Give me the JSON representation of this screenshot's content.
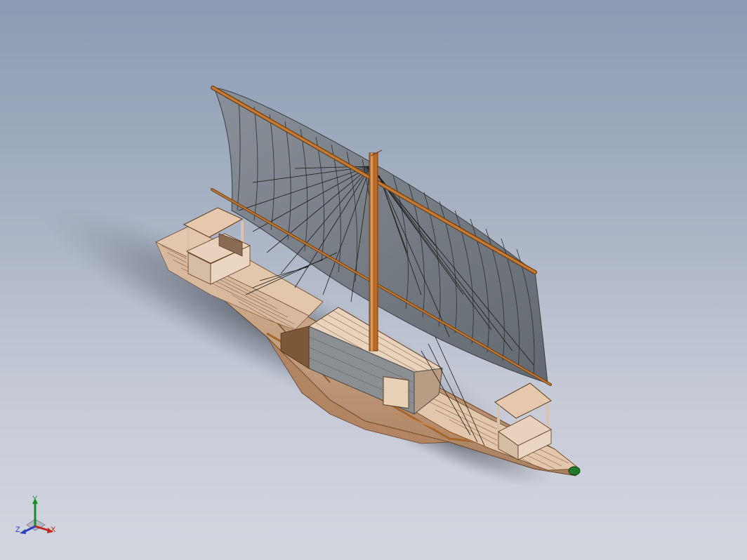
{
  "viewport": {
    "background_top": "#8a9bb3",
    "background_bottom": "#d3d6df",
    "model": "sailing-boat-3d-model"
  },
  "triad": {
    "x_label": "X",
    "y_label": "Y",
    "z_label": "Z",
    "x_color": "#c2281f",
    "y_color": "#1d8a2a",
    "z_color": "#2a3fc4"
  },
  "colors": {
    "wood_light": "#e8cdb4",
    "wood_mid": "#c8a488",
    "wood_dark": "#8a5a32",
    "spar": "#b86a28",
    "sail": "#737b83",
    "rigging": "#1a1a1a",
    "shadow": "#4a4f5a"
  }
}
